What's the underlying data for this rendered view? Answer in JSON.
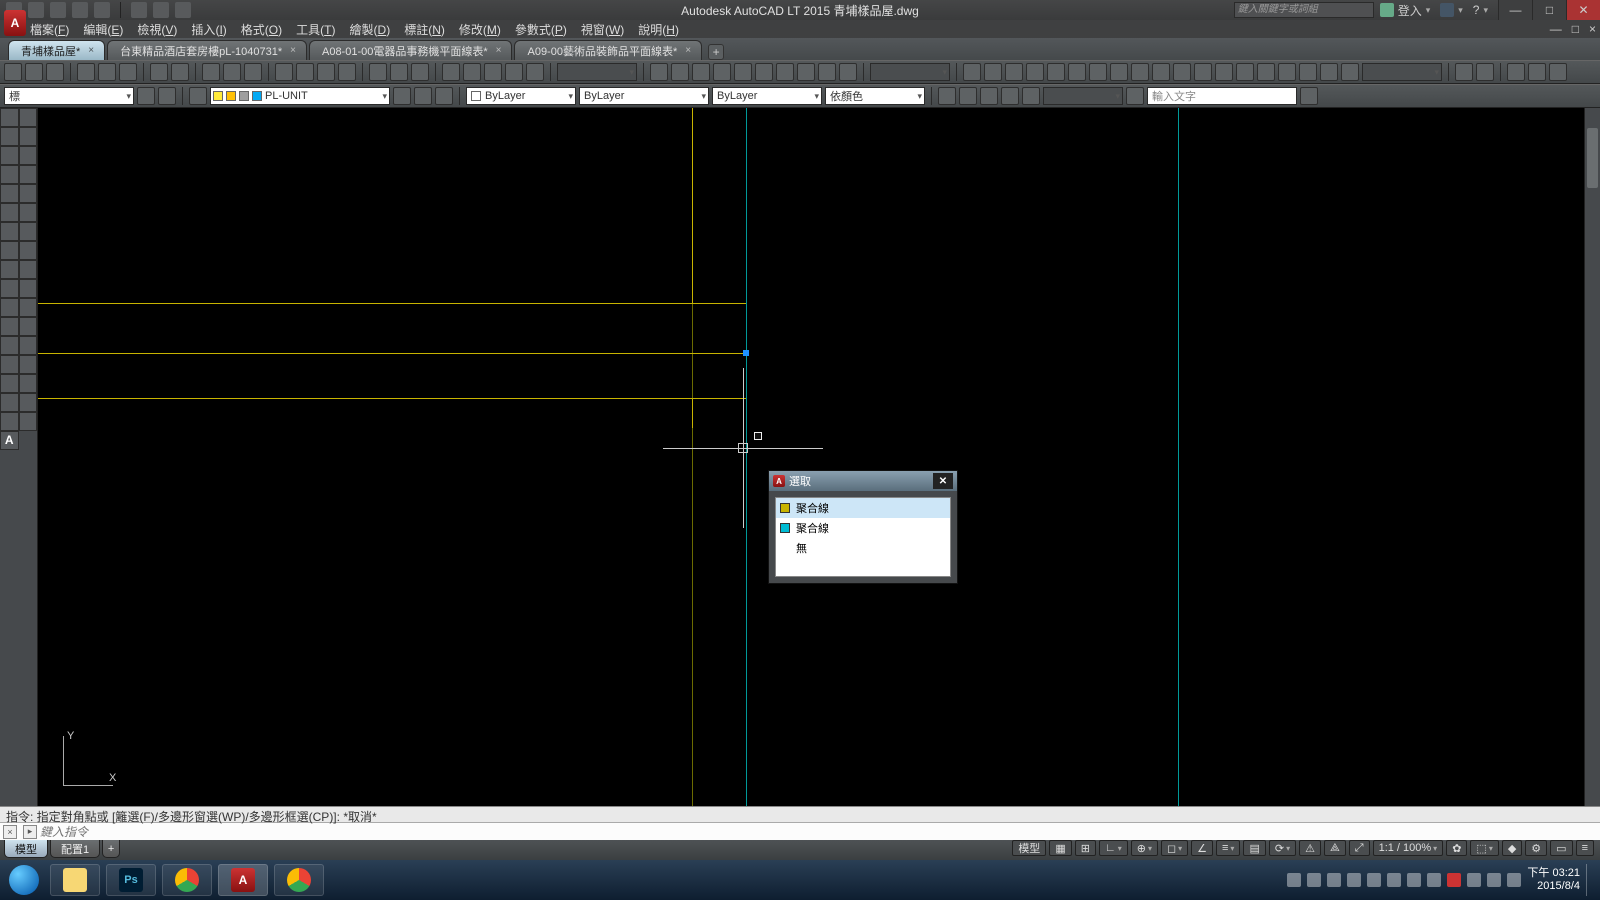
{
  "titlebar": {
    "title": "Autodesk AutoCAD LT 2015   青埔樣品屋.dwg",
    "search_placeholder": "鍵入關鍵字或詞組",
    "signin": "登入",
    "help_glyph": "?",
    "min_glyph": "—",
    "max_glyph": "□",
    "close_glyph": "✕"
  },
  "menubar": {
    "items": [
      {
        "label": "檔案",
        "hot": "F"
      },
      {
        "label": "編輯",
        "hot": "E"
      },
      {
        "label": "檢視",
        "hot": "V"
      },
      {
        "label": "插入",
        "hot": "I"
      },
      {
        "label": "格式",
        "hot": "O"
      },
      {
        "label": "工具",
        "hot": "T"
      },
      {
        "label": "繪製",
        "hot": "D"
      },
      {
        "label": "標註",
        "hot": "N"
      },
      {
        "label": "修改",
        "hot": "M"
      },
      {
        "label": "參數式",
        "hot": "P"
      },
      {
        "label": "視窗",
        "hot": "W"
      },
      {
        "label": "說明",
        "hot": "H"
      }
    ],
    "mini_min": "—",
    "mini_max": "□",
    "mini_close": "×"
  },
  "filetabs": {
    "tabs": [
      {
        "label": "青埔樣品屋*",
        "active": true
      },
      {
        "label": "台東精品酒店套房樓pL-1040731*",
        "active": false
      },
      {
        "label": "A08-01-00電器品事務機平面線表*",
        "active": false
      },
      {
        "label": "A09-00藝術品裝飾品平面線表*",
        "active": false
      }
    ],
    "plus": "+"
  },
  "toolbar2": {
    "style_combo": "標",
    "layer_label": "PL-UNIT",
    "color_combo": "ByLayer",
    "ltype_combo": "ByLayer",
    "lweight_combo": "ByLayer",
    "plot_combo": "依顏色",
    "text_combo": "",
    "find_placeholder": "輸入文字"
  },
  "popup": {
    "title": "選取",
    "options": [
      {
        "label": "聚合線",
        "swatch": "#c8b400",
        "selected": true
      },
      {
        "label": "聚合線",
        "swatch": "#00bcd4",
        "selected": false
      },
      {
        "label": "無",
        "swatch": "",
        "selected": false
      }
    ],
    "close": "✕"
  },
  "cmd": {
    "history": "指令: 指定對角點或 [籬選(F)/多邊形窗選(WP)/多邊形框選(CP)]: *取消*",
    "placeholder": "鍵入指令",
    "chevron": "▸"
  },
  "mltabs": {
    "model": "模型",
    "layout1": "配置1",
    "plus": "+"
  },
  "status": {
    "modelbtn": "模型",
    "scale": "1:1 / 100%",
    "gear": "✿"
  },
  "taskbar": {
    "time": "下午 03:21",
    "date": "2015/8/4"
  }
}
